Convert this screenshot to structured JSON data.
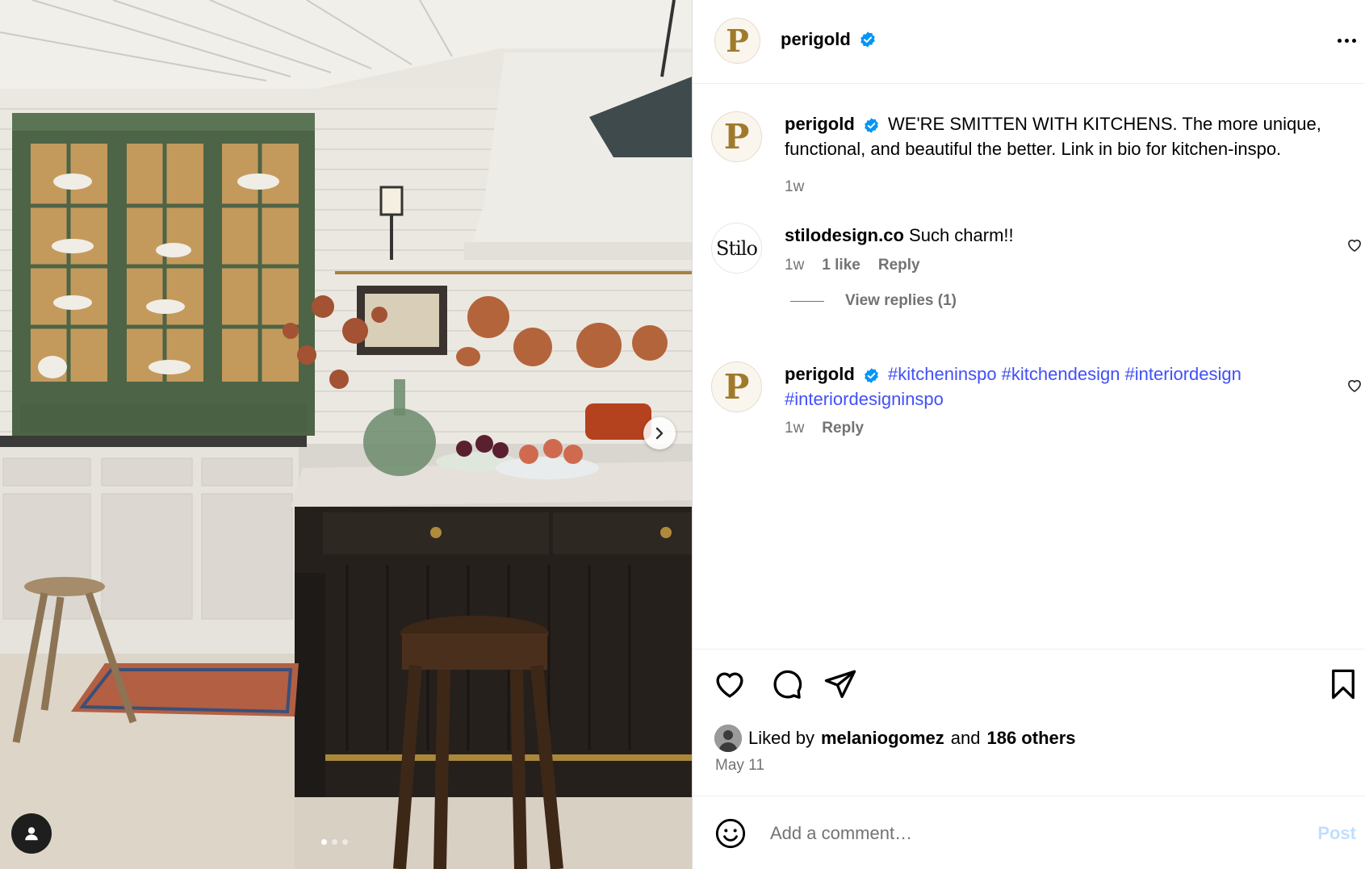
{
  "photo": {
    "alt_icon": "kitchen-photo",
    "carousel_total": 3,
    "carousel_active": 1
  },
  "header": {
    "username": "perigold",
    "avatar_letter": "P"
  },
  "caption": {
    "username": "perigold",
    "avatar_letter": "P",
    "text": "WE'RE SMITTEN WITH KITCHENS. The more unique, functional, and beautiful the better. Link in bio for kitchen-inspo.",
    "time": "1w"
  },
  "comments": [
    {
      "username": "stilodesign.co",
      "avatar_text": "Stilo",
      "text": "Such charm!!",
      "time": "1w",
      "likes": "1 like",
      "reply": "Reply",
      "view_replies": "View replies (1)"
    },
    {
      "username": "perigold",
      "avatar_letter": "P",
      "hashtags_line1": "#kitcheninspo #kitchendesign #interiordesign",
      "hashtags_line2": "#interiordesigninspo",
      "time": "1w",
      "reply": "Reply"
    }
  ],
  "likes": {
    "prefix": "Liked by",
    "user": "melaniogomez",
    "conj": "and",
    "others": "186 others"
  },
  "date": "May 11",
  "add_comment": {
    "placeholder": "Add a comment…",
    "post_label": "Post"
  },
  "colors": {
    "verified": "#0095f6",
    "hashtag": "#4150f7",
    "post_disabled": "#c0dffd",
    "brand_gold": "#a07a2c"
  }
}
